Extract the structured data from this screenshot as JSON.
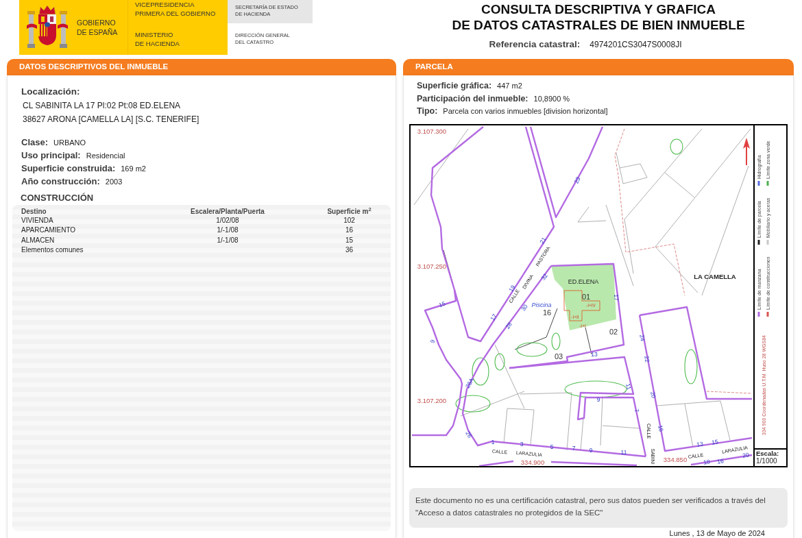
{
  "header": {
    "government": [
      "GOBIERNO",
      "DE ESPAÑA"
    ],
    "vicepresidency": [
      "VICEPRESIDENCIA",
      "PRIMERA DEL GOBIERNO"
    ],
    "ministry": [
      "MINISTERIO",
      "DE HACIENDA"
    ],
    "secretariat": [
      "SECRETARÍA DE ESTADO",
      "DE HACIENDA"
    ],
    "directorate": [
      "DIRECCIÓN GENERAL",
      "DEL CATASTRO"
    ]
  },
  "title": [
    "CONSULTA DESCRIPTIVA Y GRAFICA",
    "DE DATOS CATASTRALES DE BIEN INMUEBLE"
  ],
  "reference": {
    "label": "Referencia catastral:",
    "value": "4974201CS3047S0008JI"
  },
  "descriptive": {
    "heading": "DATOS DESCRIPTIVOS DEL INMUEBLE",
    "location_label": "Localización:",
    "address": [
      "CL SABINITA LA 17 Pl:02 Pt:08 ED.ELENA",
      "38627 ARONA [CAMELLA LA] [S.C. TENERIFE]"
    ],
    "fields": [
      {
        "label": "Clase:",
        "value": "URBANO"
      },
      {
        "label": "Uso principal:",
        "value": "Residencial"
      },
      {
        "label": "Superficie construida:",
        "value": "169 m2"
      },
      {
        "label": "Año construcción:",
        "value": "2003"
      }
    ],
    "construction": {
      "heading": "CONSTRUCCIÓN",
      "columns": [
        "Destino",
        "Escalera/Planta/Puerta",
        "Superficie m$^{2}$"
      ],
      "rows": [
        [
          "VIVIENDA",
          "1/02/08",
          "102"
        ],
        [
          "APARCAMIENTO",
          "1/-1/08",
          "16"
        ],
        [
          "ALMACEN",
          "1/-1/08",
          "15"
        ],
        [
          "Elementos comunes",
          "",
          "36"
        ]
      ]
    }
  },
  "parcel": {
    "heading": "PARCELA",
    "fields": [
      {
        "label": "Superficie gráfica:",
        "value": "447 m2"
      },
      {
        "label": "Participación del inmueble:",
        "value": "10,8900 %"
      },
      {
        "label": "Tipo:",
        "value": "Parcela con varios inmuebles [division horizontal]"
      }
    ],
    "map": {
      "labels": [
        {
          "kind": "coordinate",
          "text": "3.107.300"
        },
        {
          "kind": "house_number",
          "text": "23"
        },
        {
          "kind": "place",
          "text": "LA CAMELLA"
        },
        {
          "kind": "house_number",
          "text": "21"
        },
        {
          "kind": "street",
          "text": "PASTORA"
        },
        {
          "kind": "coordinate",
          "text": "3.107.250"
        },
        {
          "kind": "house_number",
          "text": "32"
        },
        {
          "kind": "street",
          "text": "DIVINA"
        },
        {
          "kind": "building",
          "text": "ED.ELENA"
        },
        {
          "kind": "house_number",
          "text": "19"
        },
        {
          "kind": "parcel_number",
          "text": "01"
        },
        {
          "kind": "street",
          "text": "CALLE"
        },
        {
          "kind": "house_number",
          "text": "17"
        },
        {
          "kind": "pool",
          "text": "Piscina"
        },
        {
          "kind": "floor_code",
          "text": "-I+IV"
        },
        {
          "kind": "house_number",
          "text": "15"
        },
        {
          "kind": "parcel_number",
          "text": "16"
        },
        {
          "kind": "floor_code",
          "text": "-I+II"
        },
        {
          "kind": "house_number",
          "text": "30"
        },
        {
          "kind": "house_number",
          "text": "17"
        },
        {
          "kind": "floor_code",
          "text": "-I+I"
        },
        {
          "kind": "house_number",
          "text": "28"
        },
        {
          "kind": "parcel_number",
          "text": "02"
        },
        {
          "kind": "house_number",
          "text": "24"
        },
        {
          "kind": "house_number",
          "text": "9"
        },
        {
          "kind": "parcel_number",
          "text": "03"
        },
        {
          "kind": "house_number",
          "text": "13"
        },
        {
          "kind": "house_number",
          "text": "22"
        },
        {
          "kind": "house_number",
          "text": "26A"
        },
        {
          "kind": "house_number",
          "text": "11"
        },
        {
          "kind": "house_number",
          "text": "20"
        },
        {
          "kind": "coordinate",
          "text": "3.107.200"
        },
        {
          "kind": "house_number",
          "text": "9"
        },
        {
          "kind": "house_number",
          "text": "7"
        },
        {
          "kind": "house_number",
          "text": "16"
        },
        {
          "kind": "street",
          "text": "CALLE"
        },
        {
          "kind": "house_number",
          "text": "26"
        },
        {
          "kind": "house_number",
          "text": "1"
        },
        {
          "kind": "house_number",
          "text": "3"
        },
        {
          "kind": "house_number",
          "text": "13"
        },
        {
          "kind": "house_number",
          "text": "5"
        },
        {
          "kind": "house_number",
          "text": "15"
        },
        {
          "kind": "house_number",
          "text": "7"
        },
        {
          "kind": "house_number",
          "text": "9"
        },
        {
          "kind": "house_number",
          "text": "11"
        },
        {
          "kind": "street",
          "text": "CALLE"
        },
        {
          "kind": "street",
          "text": "LARAZULIA"
        },
        {
          "kind": "street",
          "text": "LARAZULIA"
        },
        {
          "kind": "house_number",
          "text": "20"
        },
        {
          "kind": "street",
          "text": "SABINI"
        },
        {
          "kind": "coordinate",
          "text": "334.850"
        },
        {
          "kind": "street",
          "text": "CALLE"
        },
        {
          "kind": "house_number",
          "text": "18"
        },
        {
          "kind": "house_number",
          "text": "16"
        },
        {
          "kind": "coordinate",
          "text": "334.900"
        }
      ],
      "coordinates_note": "334 900 Coordenadas U.T.M. Huso 28 WGS84",
      "legend": [
        {
          "label": "Límite de manzana",
          "color": "#b36ae2"
        },
        {
          "label": "Límite de construcciones",
          "color": "#d9534f"
        },
        {
          "label": "Límite de parcela",
          "color": "#222222"
        },
        {
          "label": "Mobiliario y aceras",
          "color": "#c8c8c8"
        },
        {
          "label": "Hidrografía",
          "color": "#5b6ee1"
        },
        {
          "label": "Límite zona verde",
          "color": "#4caf50"
        }
      ],
      "scale_label": "Escala:",
      "scale_value": "1/1000"
    }
  },
  "notice": "Este documento no es una certificación catastral, pero sus datos pueden ser verificados a través del \"Acceso a datos catastrales no protegidos de la SEC\"",
  "date": "Lunes , 13 de Mayo de 2024"
}
